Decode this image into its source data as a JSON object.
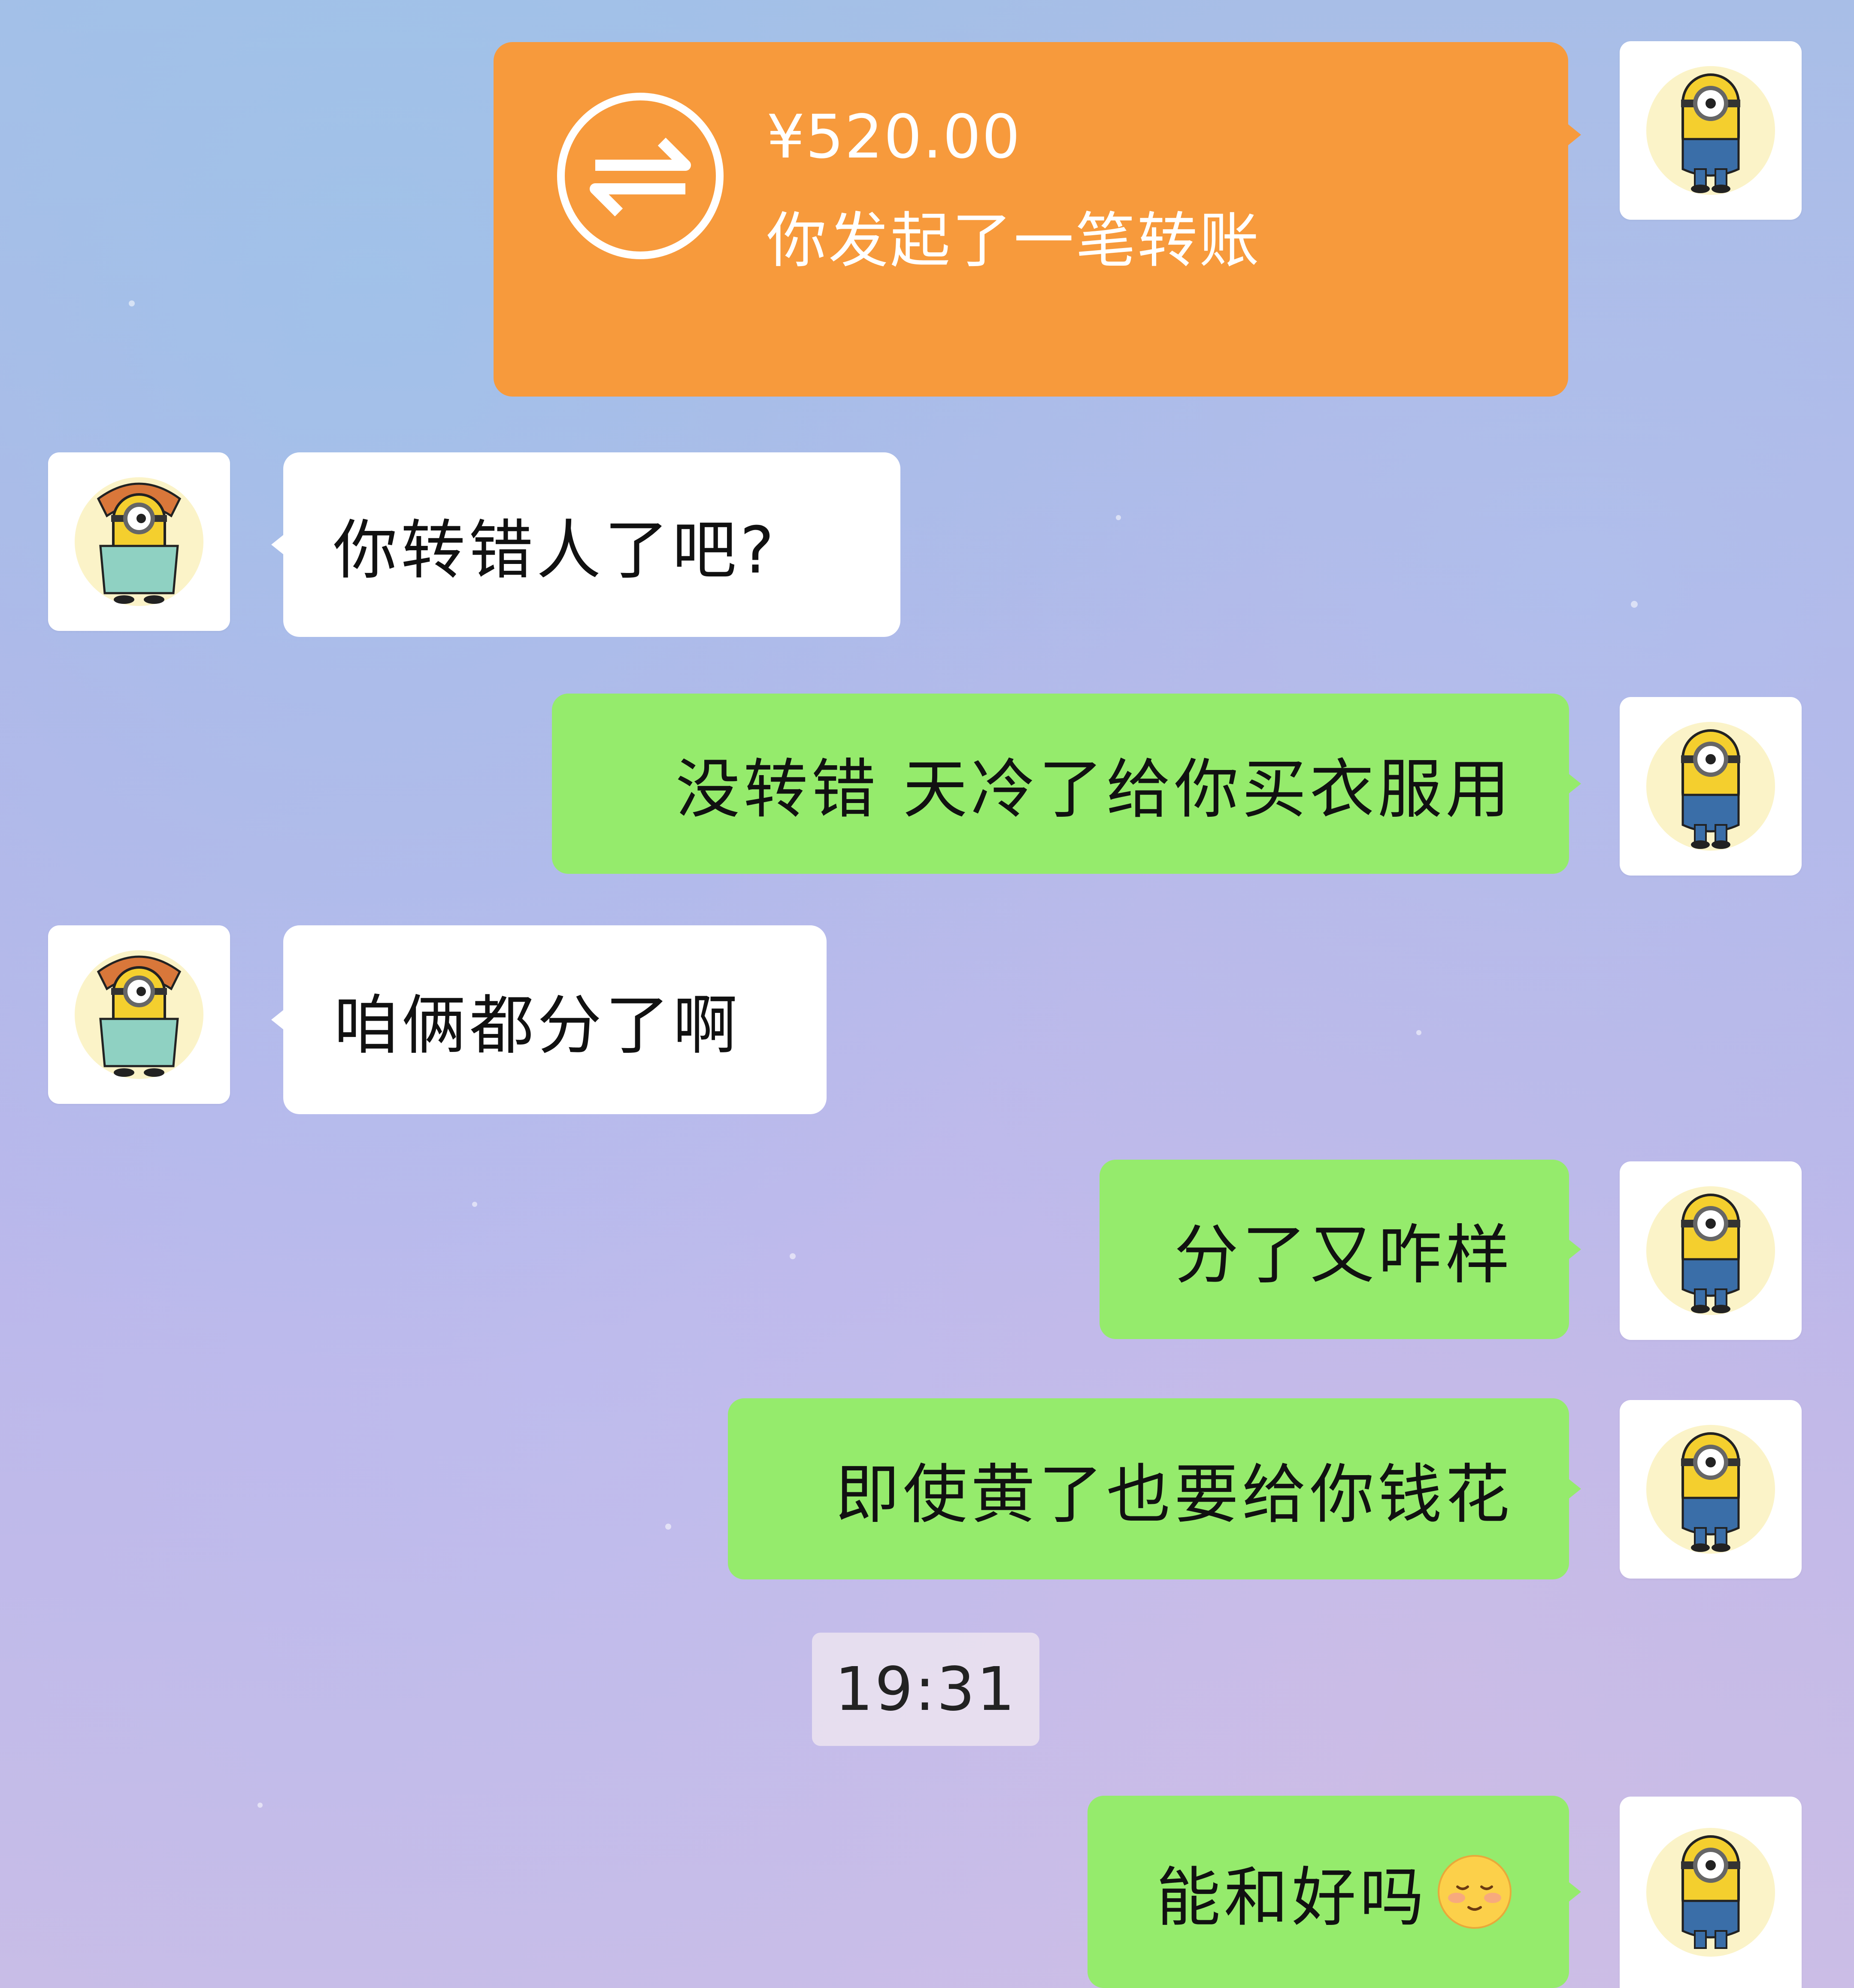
{
  "transfer": {
    "amount": "¥520.00",
    "description": "你发起了一笔转账",
    "icon": "transfer-arrows-icon",
    "color": "#f79a3c"
  },
  "messages": [
    {
      "side": "in",
      "text": "你转错人了吧?"
    },
    {
      "side": "out",
      "text": "没转错 天冷了给你买衣服用"
    },
    {
      "side": "in",
      "text": "咱俩都分了啊"
    },
    {
      "side": "out",
      "text": "分了又咋样"
    },
    {
      "side": "out",
      "text": "即使黄了也要给你钱花"
    },
    {
      "side": "out",
      "text": "能和好吗",
      "emoji": "blushing-face-icon"
    }
  ],
  "timestamp": "19:31",
  "avatars": {
    "self": "minion-avatar-icon",
    "other": "minion-girl-avatar-icon"
  },
  "colors": {
    "outgoing_bubble": "#95eb6c",
    "incoming_bubble": "#ffffff",
    "transfer_card": "#f79a3c"
  }
}
